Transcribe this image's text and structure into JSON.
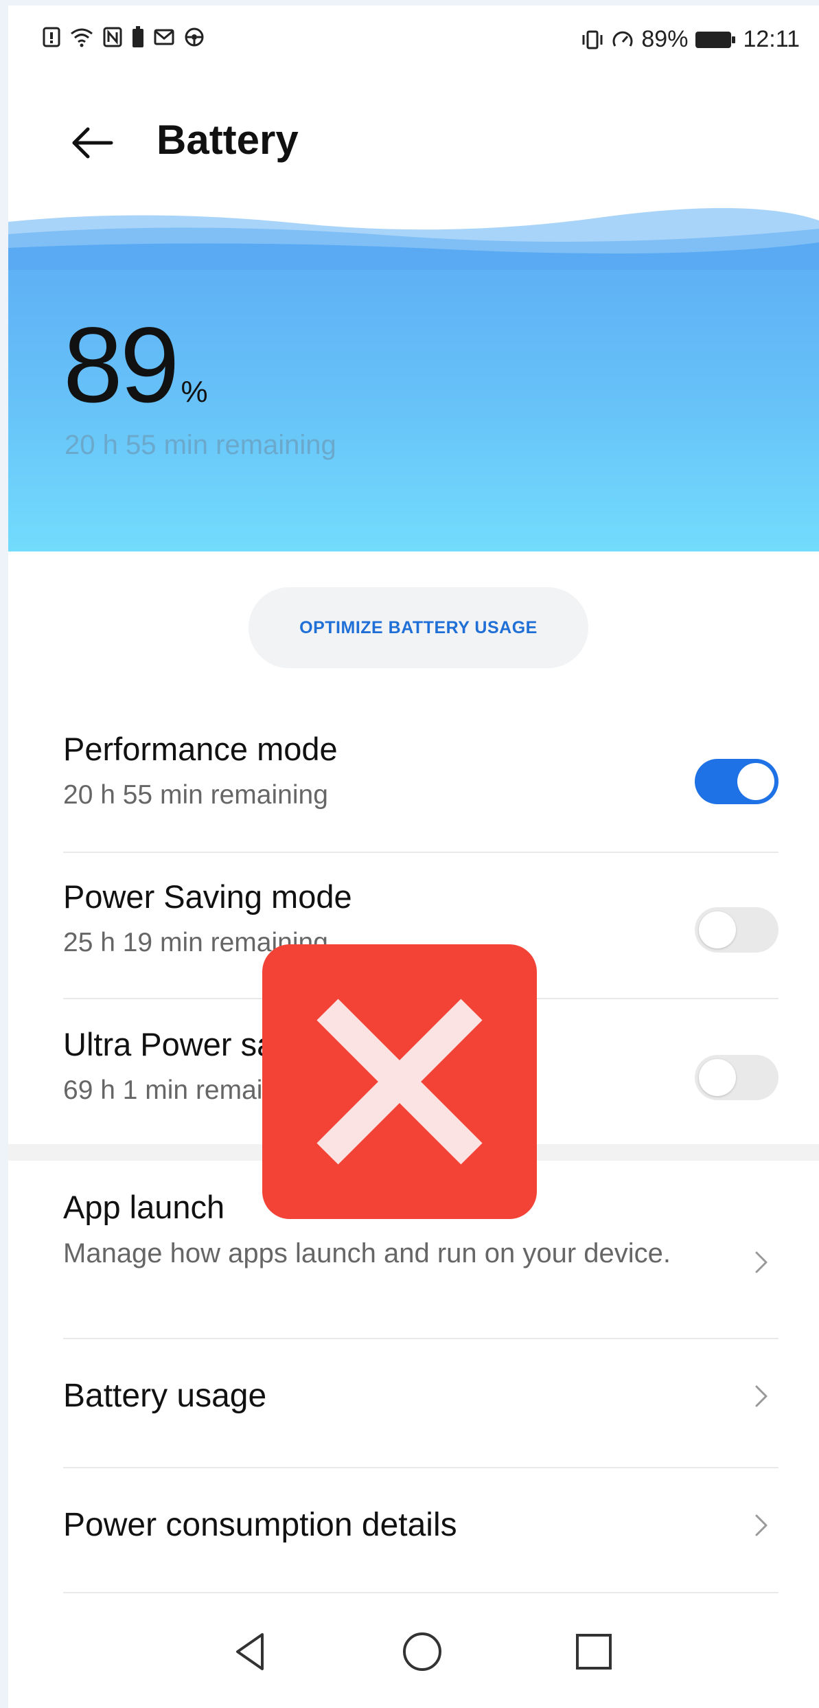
{
  "status_bar": {
    "battery_percent": "89%",
    "time": "12:11",
    "icons": [
      "notification-icon",
      "wifi-icon",
      "nfc-icon",
      "battery-saver-icon",
      "mail-icon",
      "drive-icon",
      "vibrate-icon",
      "speed-icon",
      "battery-icon"
    ]
  },
  "header": {
    "title": "Battery"
  },
  "hero": {
    "percent_value": "89",
    "percent_unit": "%",
    "remaining": "20 h 55 min remaining",
    "level_fraction": 0.89
  },
  "optimize_label": "OPTIMIZE BATTERY USAGE",
  "modes": [
    {
      "title": "Performance mode",
      "subtitle": "20 h 55 min remaining",
      "enabled": true
    },
    {
      "title": "Power Saving mode",
      "subtitle": "25 h 19 min remaining",
      "enabled": false
    },
    {
      "title": "Ultra Power saving",
      "subtitle": "69 h 1 min remaining",
      "enabled": false
    }
  ],
  "links": [
    {
      "title": "App launch",
      "subtitle": "Manage how apps launch and run on your device."
    },
    {
      "title": "Battery usage"
    },
    {
      "title": "Power consumption details"
    }
  ],
  "colors": {
    "accent": "#1f72e6",
    "overlay": "#f24336",
    "hero_top": "#5aaaf3",
    "hero_bottom": "#72dcfc"
  }
}
